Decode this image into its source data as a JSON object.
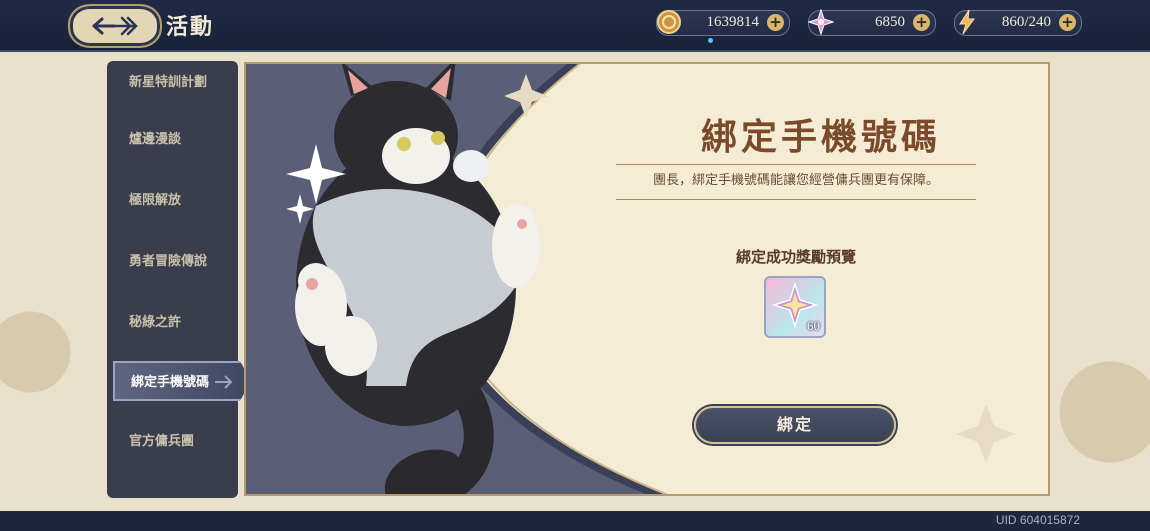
{
  "header": {
    "title": "活動",
    "back_icon": "back-arrow-icon",
    "resources": [
      {
        "name": "gold",
        "icon": "gold-coin-icon",
        "value": "1639814"
      },
      {
        "name": "crystal",
        "icon": "crystal-icon",
        "value": "6850"
      },
      {
        "name": "stamina",
        "icon": "lightning-icon",
        "value": "860/240"
      }
    ]
  },
  "sidebar": {
    "items": [
      {
        "label": "新星特訓計劃",
        "active": false
      },
      {
        "label": "爐邊漫談",
        "active": false
      },
      {
        "label": "極限解放",
        "active": false
      },
      {
        "label": "勇者冒險傳說",
        "active": false
      },
      {
        "label": "秘綠之許",
        "active": false
      },
      {
        "label": "綁定手機號碼",
        "active": true
      },
      {
        "label": "官方傭兵團",
        "active": false
      }
    ]
  },
  "main": {
    "headline": "綁定手機號碼",
    "subline": "團長，綁定手機號碼能讓您經營傭兵團更有保障。",
    "reward_title": "綁定成功獎勵預覽",
    "reward": {
      "icon": "crystal-icon",
      "count": "60"
    },
    "bind_label": "綁定"
  },
  "footer": {
    "uid": "UID 604015872"
  },
  "colors": {
    "accent_brown": "#7a4a2a",
    "bar_navy": "#1f2a45",
    "gold": "#d9b66b"
  }
}
